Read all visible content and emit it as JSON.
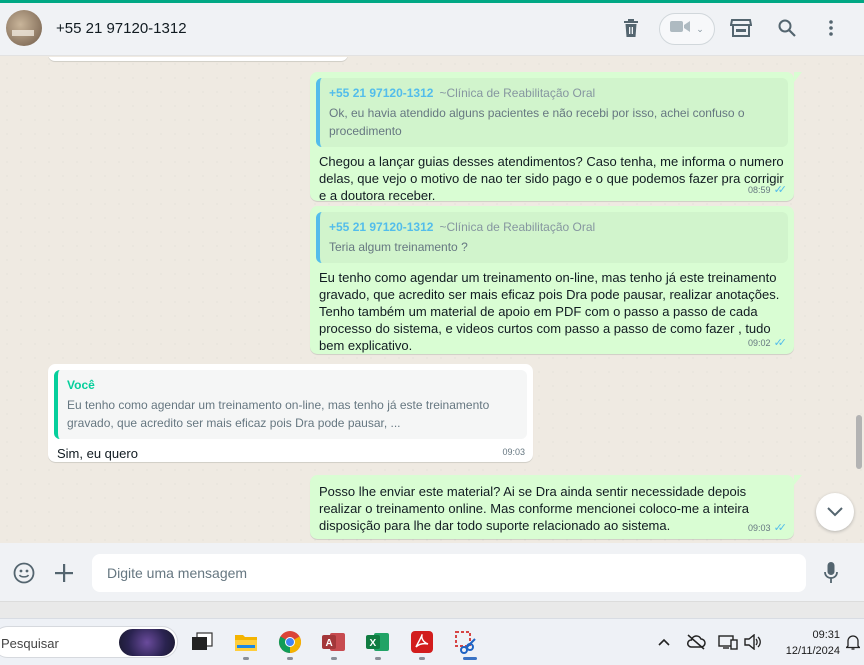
{
  "header": {
    "contact_name": "+55 21 97120-1312",
    "icons": [
      "delete-icon",
      "video-call-icon",
      "store-icon",
      "search-icon",
      "menu-icon"
    ]
  },
  "messages": [
    {
      "direction": "out",
      "quote": {
        "author": "+55 21 97120-1312",
        "org": "~Clínica de Reabilitação Oral",
        "text": "Ok, eu havia atendido alguns pacientes e não recebi por isso, achei confuso o procedimento"
      },
      "text": "Chegou a lançar guias desses atendimentos? Caso tenha, me informa o numero delas, que vejo o motivo de nao ter sido pago e o que podemos fazer pra corrigir e a doutora receber.",
      "time": "08:59",
      "status": "read"
    },
    {
      "direction": "out",
      "quote": {
        "author": "+55 21 97120-1312",
        "org": "~Clínica de Reabilitação Oral",
        "text": "Teria algum treinamento ?"
      },
      "text": "Eu tenho como agendar um treinamento on-line, mas tenho já este treinamento gravado, que acredito ser mais eficaz pois Dra pode pausar, realizar anotações. Tenho também um material de apoio em PDF com o passo a passo de cada processo do sistema, e videos curtos com passo a passo de como fazer , tudo bem explicativo.",
      "time": "09:02",
      "status": "read"
    },
    {
      "direction": "in",
      "quote": {
        "author": "Você",
        "text": "Eu tenho como agendar um treinamento on-line, mas tenho já este treinamento gravado, que acredito ser mais eficaz pois Dra pode pausar, ..."
      },
      "text": "Sim, eu quero",
      "time": "09:03"
    },
    {
      "direction": "out",
      "text": "Posso lhe enviar este material? Ai se Dra ainda sentir necessidade depois realizar o treinamento online. Mas conforme mencionei coloco-me a inteira disposição para lhe dar todo suporte relacionado ao sistema.",
      "time": "09:03",
      "status": "read"
    }
  ],
  "compose": {
    "placeholder": "Digite uma mensagem",
    "icons": [
      "emoji-icon",
      "attach-plus-icon",
      "microphone-icon"
    ]
  },
  "taskbar": {
    "search_placeholder": "Pesquisar",
    "apps": [
      "task-view",
      "file-explorer",
      "chrome",
      "access",
      "excel",
      "acrobat",
      "snipping-tool"
    ],
    "time": "09:31",
    "date": "12/11/2024"
  },
  "colors": {
    "accent": "#00a884",
    "outgoing_bubble": "#d9fdd3",
    "read_ticks": "#53bdeb",
    "quote_author_out": "#53bdeb",
    "quote_author_in": "#06cf9c"
  }
}
